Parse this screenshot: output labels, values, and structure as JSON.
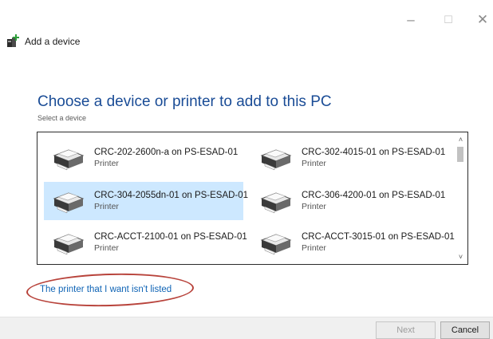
{
  "window": {
    "controls": {
      "minimize": "–",
      "maximize": "☐",
      "close": "✕"
    },
    "title": "Add a device"
  },
  "main": {
    "heading": "Choose a device or printer to add to this PC",
    "subheading": "Select a device"
  },
  "devices": [
    {
      "name": "CRC-202-2600n-a on PS-ESAD-01",
      "type": "Printer",
      "selected": false
    },
    {
      "name": "CRC-302-4015-01 on PS-ESAD-01",
      "type": "Printer",
      "selected": false
    },
    {
      "name": "CRC-304-2055dn-01 on PS-ESAD-01",
      "type": "Printer",
      "selected": true
    },
    {
      "name": "CRC-306-4200-01 on PS-ESAD-01",
      "type": "Printer",
      "selected": false
    },
    {
      "name": "CRC-ACCT-2100-01 on PS-ESAD-01",
      "type": "Printer",
      "selected": false
    },
    {
      "name": "CRC-ACCT-3015-01 on PS-ESAD-01",
      "type": "Printer",
      "selected": false
    }
  ],
  "scrollbar": {
    "up": "˄",
    "down": "˅"
  },
  "link": {
    "label": "The printer that I want isn't listed"
  },
  "footer": {
    "next_label": "Next",
    "cancel_label": "Cancel"
  },
  "colors": {
    "heading": "#1a4c96",
    "link": "#0e63b5",
    "selection": "#cde8ff",
    "annotation_circle": "#b8433b"
  },
  "icons": {
    "title": "add-device-icon",
    "device": "printer-icon"
  }
}
